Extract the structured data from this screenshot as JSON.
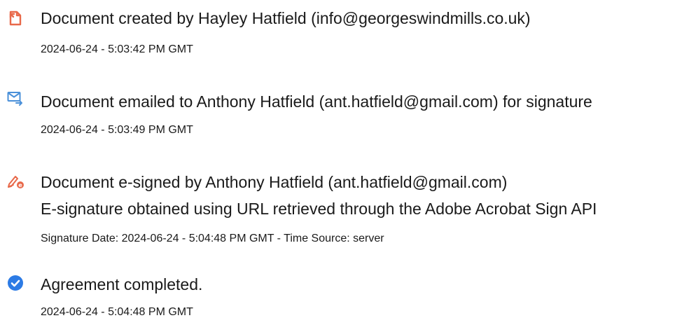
{
  "audit_trail": {
    "events": [
      {
        "icon": "document-created-icon",
        "title": "Document created by Hayley Hatfield (info@georgeswindmills.co.uk)",
        "timestamp": "2024-06-24 - 5:03:42 PM GMT"
      },
      {
        "icon": "email-sent-icon",
        "title": "Document emailed to Anthony Hatfield (ant.hatfield@gmail.com) for signature",
        "timestamp": "2024-06-24 - 5:03:49 PM GMT"
      },
      {
        "icon": "e-sign-icon",
        "title": "Document e-signed by Anthony Hatfield (ant.hatfield@gmail.com)",
        "detail": "E-signature obtained using URL retrieved through the Adobe Acrobat Sign API",
        "timestamp": "Signature Date: 2024-06-24 - 5:04:48 PM GMT - Time Source: server"
      },
      {
        "icon": "checkmark-circle-icon",
        "title": "Agreement completed.",
        "timestamp": "2024-06-24 - 5:04:48 PM GMT"
      }
    ],
    "colors": {
      "created_icon": "#e8694a",
      "email_icon": "#4a90d9",
      "esign_icon": "#e8694a",
      "complete_icon": "#2c7be5"
    }
  }
}
